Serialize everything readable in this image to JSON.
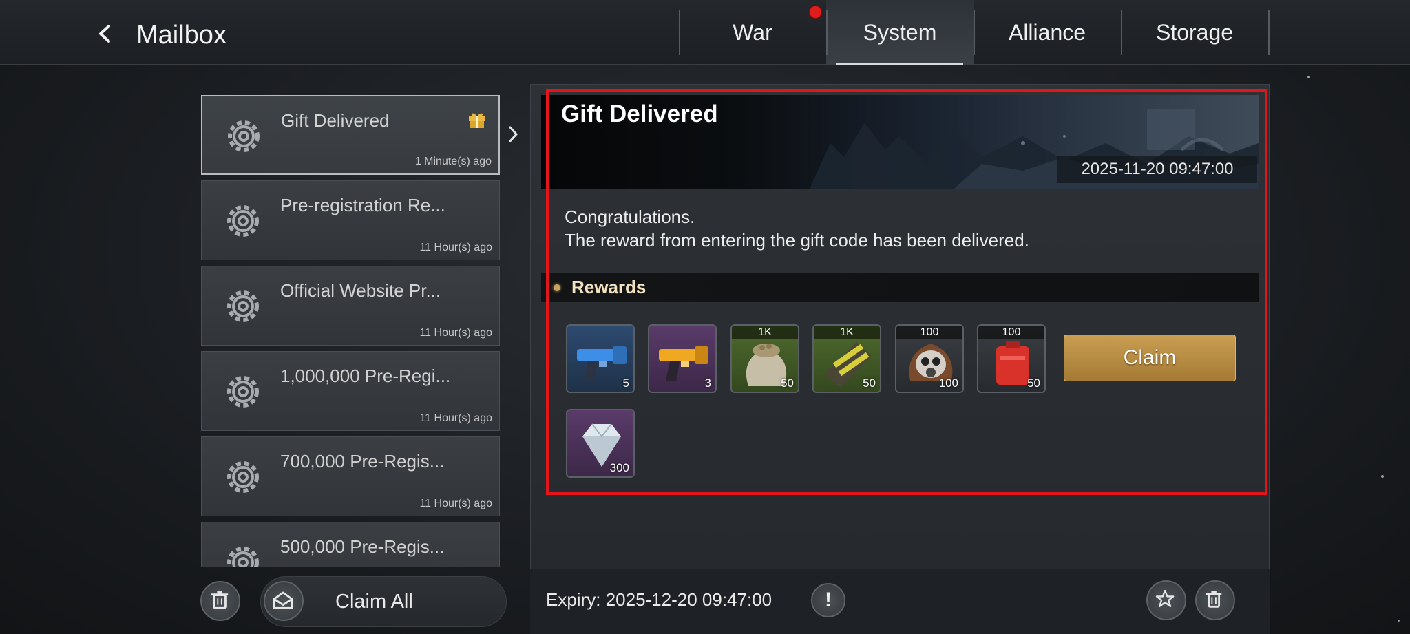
{
  "header": {
    "title": "Mailbox",
    "tabs": [
      {
        "label": "War"
      },
      {
        "label": "System"
      },
      {
        "label": "Alliance"
      },
      {
        "label": "Storage"
      }
    ],
    "active_tab": "System"
  },
  "mail_list": [
    {
      "title": "Gift Delivered",
      "time": "1 Minute(s) ago",
      "selected": true
    },
    {
      "title": "Pre-registration Re...",
      "time": "11 Hour(s) ago"
    },
    {
      "title": "Official Website Pr...",
      "time": "11 Hour(s) ago"
    },
    {
      "title": "1,000,000 Pre-Regi...",
      "time": "11 Hour(s) ago"
    },
    {
      "title": "700,000 Pre-Regis...",
      "time": "11 Hour(s) ago"
    },
    {
      "title": "500,000 Pre-Regis...",
      "time": ""
    }
  ],
  "footer_left": {
    "claim_all_label": "Claim All"
  },
  "detail": {
    "title": "Gift Delivered",
    "date": "2025-11-20 09:47:00",
    "body_line1": "Congratulations.",
    "body_line2": "The reward from entering the gift code has been delivered.",
    "rewards_label": "Rewards",
    "rewards": [
      {
        "icon": "blue-flare-gun-icon",
        "count": "5",
        "tag": ""
      },
      {
        "icon": "gold-flare-gun-icon",
        "count": "3",
        "tag": ""
      },
      {
        "icon": "supply-sack-icon",
        "count": "50",
        "tag": "1K"
      },
      {
        "icon": "wood-bundle-icon",
        "count": "50",
        "tag": "1K"
      },
      {
        "icon": "gas-mask-icon",
        "count": "100",
        "tag": "100"
      },
      {
        "icon": "fuel-can-icon",
        "count": "50",
        "tag": "100"
      },
      {
        "icon": "diamond-icon",
        "count": "300",
        "tag": ""
      }
    ],
    "claim_label": "Claim",
    "expiry": "Expiry: 2025-12-20 09:47:00"
  },
  "colors": {
    "highlight": "#e3141a",
    "claim_button": "#b98c44",
    "notification_dot": "#e01d1d"
  }
}
